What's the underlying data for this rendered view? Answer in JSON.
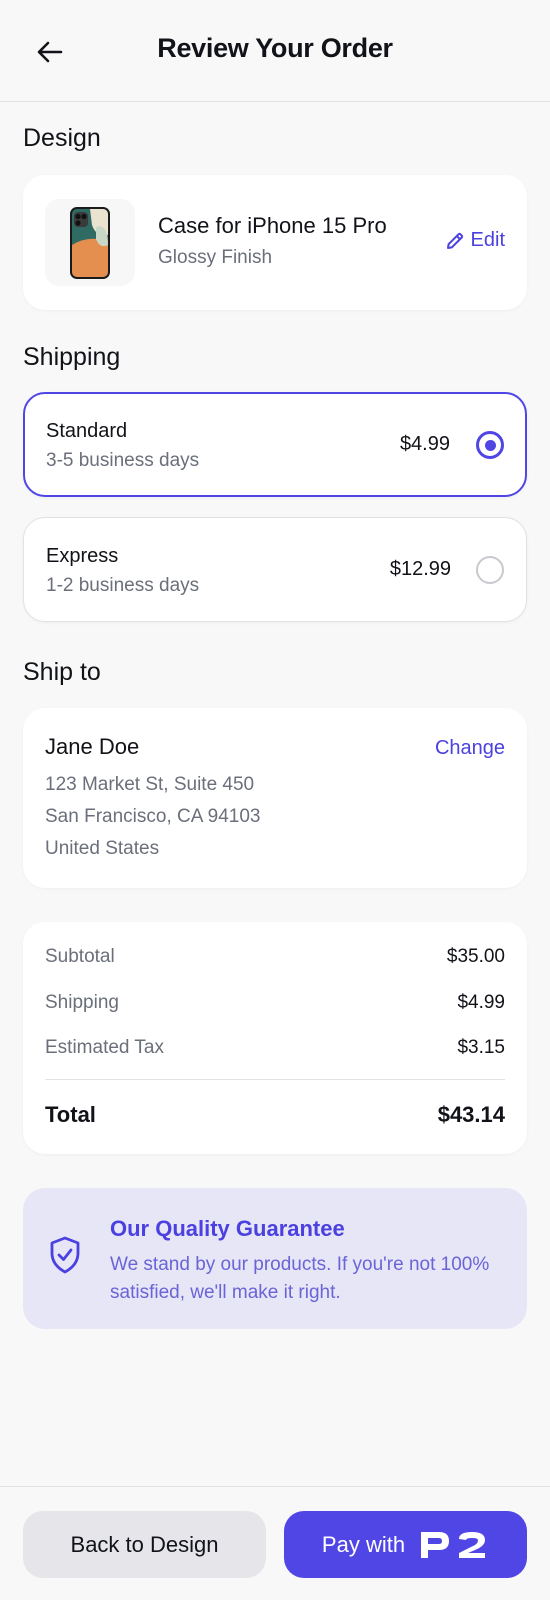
{
  "header": {
    "title": "Review Your Order",
    "back_icon": "arrow-left-icon"
  },
  "design": {
    "section_title": "Design",
    "product_name": "Case for iPhone 15 Pro",
    "finish": "Glossy Finish",
    "edit_label": "Edit",
    "edit_icon": "pencil-icon"
  },
  "shipping": {
    "section_title": "Shipping",
    "options": [
      {
        "name": "Standard",
        "days": "3-5 business days",
        "price": "$4.99",
        "selected": true
      },
      {
        "name": "Express",
        "days": "1-2 business days",
        "price": "$12.99",
        "selected": false
      }
    ]
  },
  "ship_to": {
    "section_title": "Ship to",
    "name": "Jane Doe",
    "change_label": "Change",
    "lines": [
      "123 Market St, Suite 450",
      "San Francisco, CA 94103",
      "United States"
    ]
  },
  "summary": {
    "rows": [
      {
        "label": "Subtotal",
        "value": "$35.00"
      },
      {
        "label": "Shipping",
        "value": "$4.99"
      },
      {
        "label": "Estimated Tax",
        "value": "$3.15"
      }
    ],
    "total_label": "Total",
    "total_value": "$43.14"
  },
  "guarantee": {
    "title": "Our Quality Guarantee",
    "text": "We stand by our products. If you're not 100% satisfied, we'll make it right.",
    "icon": "shield-check-icon"
  },
  "footer": {
    "back_label": "Back to Design",
    "pay_label": "Pay with",
    "pay_logo": "P2"
  },
  "colors": {
    "accent": "#5046e5",
    "guarantee_bg": "#e7e6f7",
    "background": "#f8f8f8"
  }
}
